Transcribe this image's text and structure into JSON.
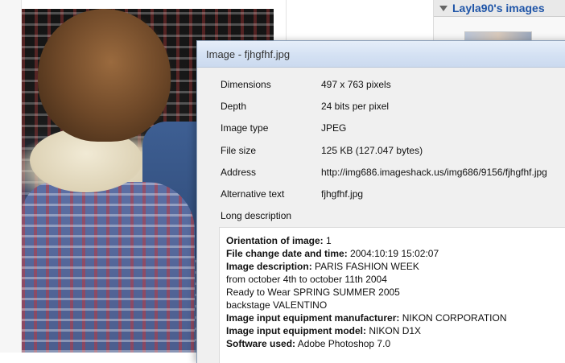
{
  "right_panel": {
    "title": "Layla90's images"
  },
  "dialog": {
    "title": "Image - fjhgfhf.jpg",
    "properties": [
      {
        "label": "Dimensions",
        "value": "497 x 763 pixels"
      },
      {
        "label": "Depth",
        "value": "24 bits per pixel"
      },
      {
        "label": "Image type",
        "value": "JPEG"
      },
      {
        "label": "File size",
        "value": "125 KB (127.047 bytes)"
      },
      {
        "label": "Address",
        "value": "http://img686.imageshack.us/img686/9156/fjhgfhf.jpg"
      },
      {
        "label": "Alternative text",
        "value": "fjhgfhf.jpg"
      },
      {
        "label": "Long description",
        "value": ""
      }
    ],
    "description": {
      "orientation": {
        "label": "Orientation of image:",
        "value": "1"
      },
      "file_change": {
        "label": "File change date and time:",
        "value": "2004:10:19 15:02:07"
      },
      "image_desc": {
        "label": "Image description:",
        "value": "PARIS FASHION WEEK",
        "extra_lines": [
          "from october 4th to october 11th 2004",
          "Ready to Wear SPRING SUMMER 2005",
          "backstage VALENTINO"
        ]
      },
      "manufacturer": {
        "label": "Image input equipment manufacturer:",
        "value": "NIKON CORPORATION"
      },
      "model": {
        "label": "Image input equipment model:",
        "value": "NIKON D1X"
      },
      "software": {
        "label": "Software used:",
        "value": "Adobe Photoshop 7.0"
      }
    }
  }
}
